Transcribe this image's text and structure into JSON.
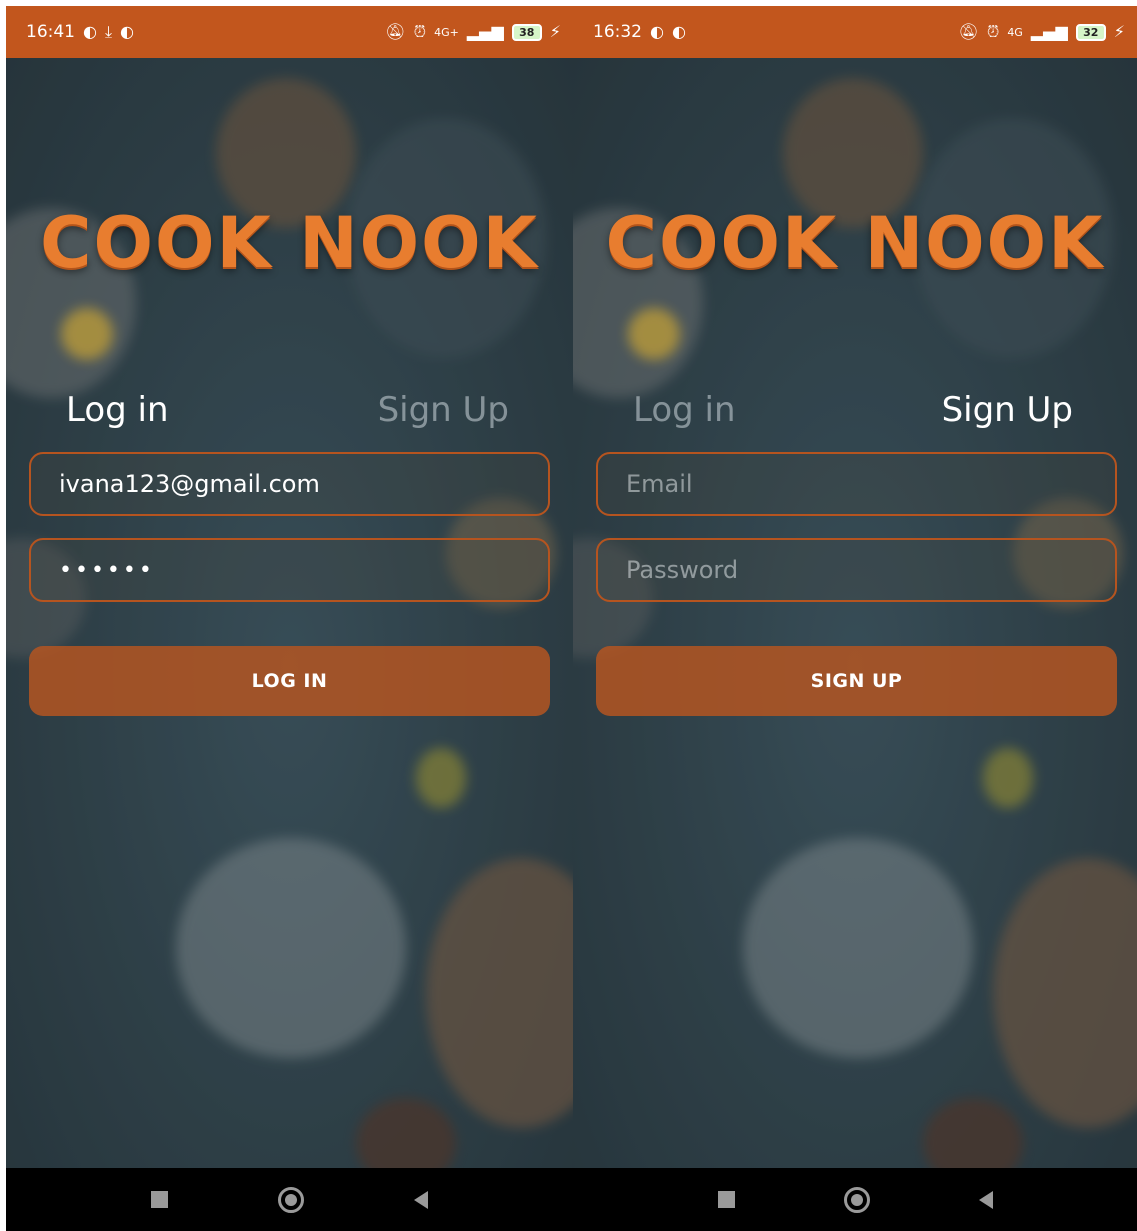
{
  "screens": [
    {
      "status": {
        "time": "16:41",
        "network": "4G+",
        "battery": "38"
      },
      "logo": "COOK NOOK",
      "tabs": {
        "login": "Log in",
        "signup": "Sign Up",
        "active": "login"
      },
      "fields": {
        "email": {
          "value": "ivana123@gmail.com",
          "placeholder": ""
        },
        "password": {
          "value": "••••••",
          "placeholder": ""
        }
      },
      "button": "LOG IN"
    },
    {
      "status": {
        "time": "16:32",
        "network": "4G",
        "battery": "32"
      },
      "logo": "COOK NOOK",
      "tabs": {
        "login": "Log in",
        "signup": "Sign Up",
        "active": "signup"
      },
      "fields": {
        "email": {
          "value": "",
          "placeholder": "Email"
        },
        "password": {
          "value": "",
          "placeholder": "Password"
        }
      },
      "button": "SIGN UP"
    }
  ],
  "icons": {
    "status_left": [
      "data-saver-icon",
      "download-icon"
    ],
    "status_right": [
      "silent-icon",
      "alarm-icon",
      "signal-icon",
      "wifi-icon",
      "battery-icon",
      "charging-icon"
    ],
    "nav": [
      "recents-icon",
      "home-icon",
      "back-icon"
    ]
  },
  "colors": {
    "accent": "#c2561d",
    "logo": "#e87d2f",
    "field_border": "#b6541f",
    "button_fill": "#b85620",
    "background": "#33474f"
  }
}
